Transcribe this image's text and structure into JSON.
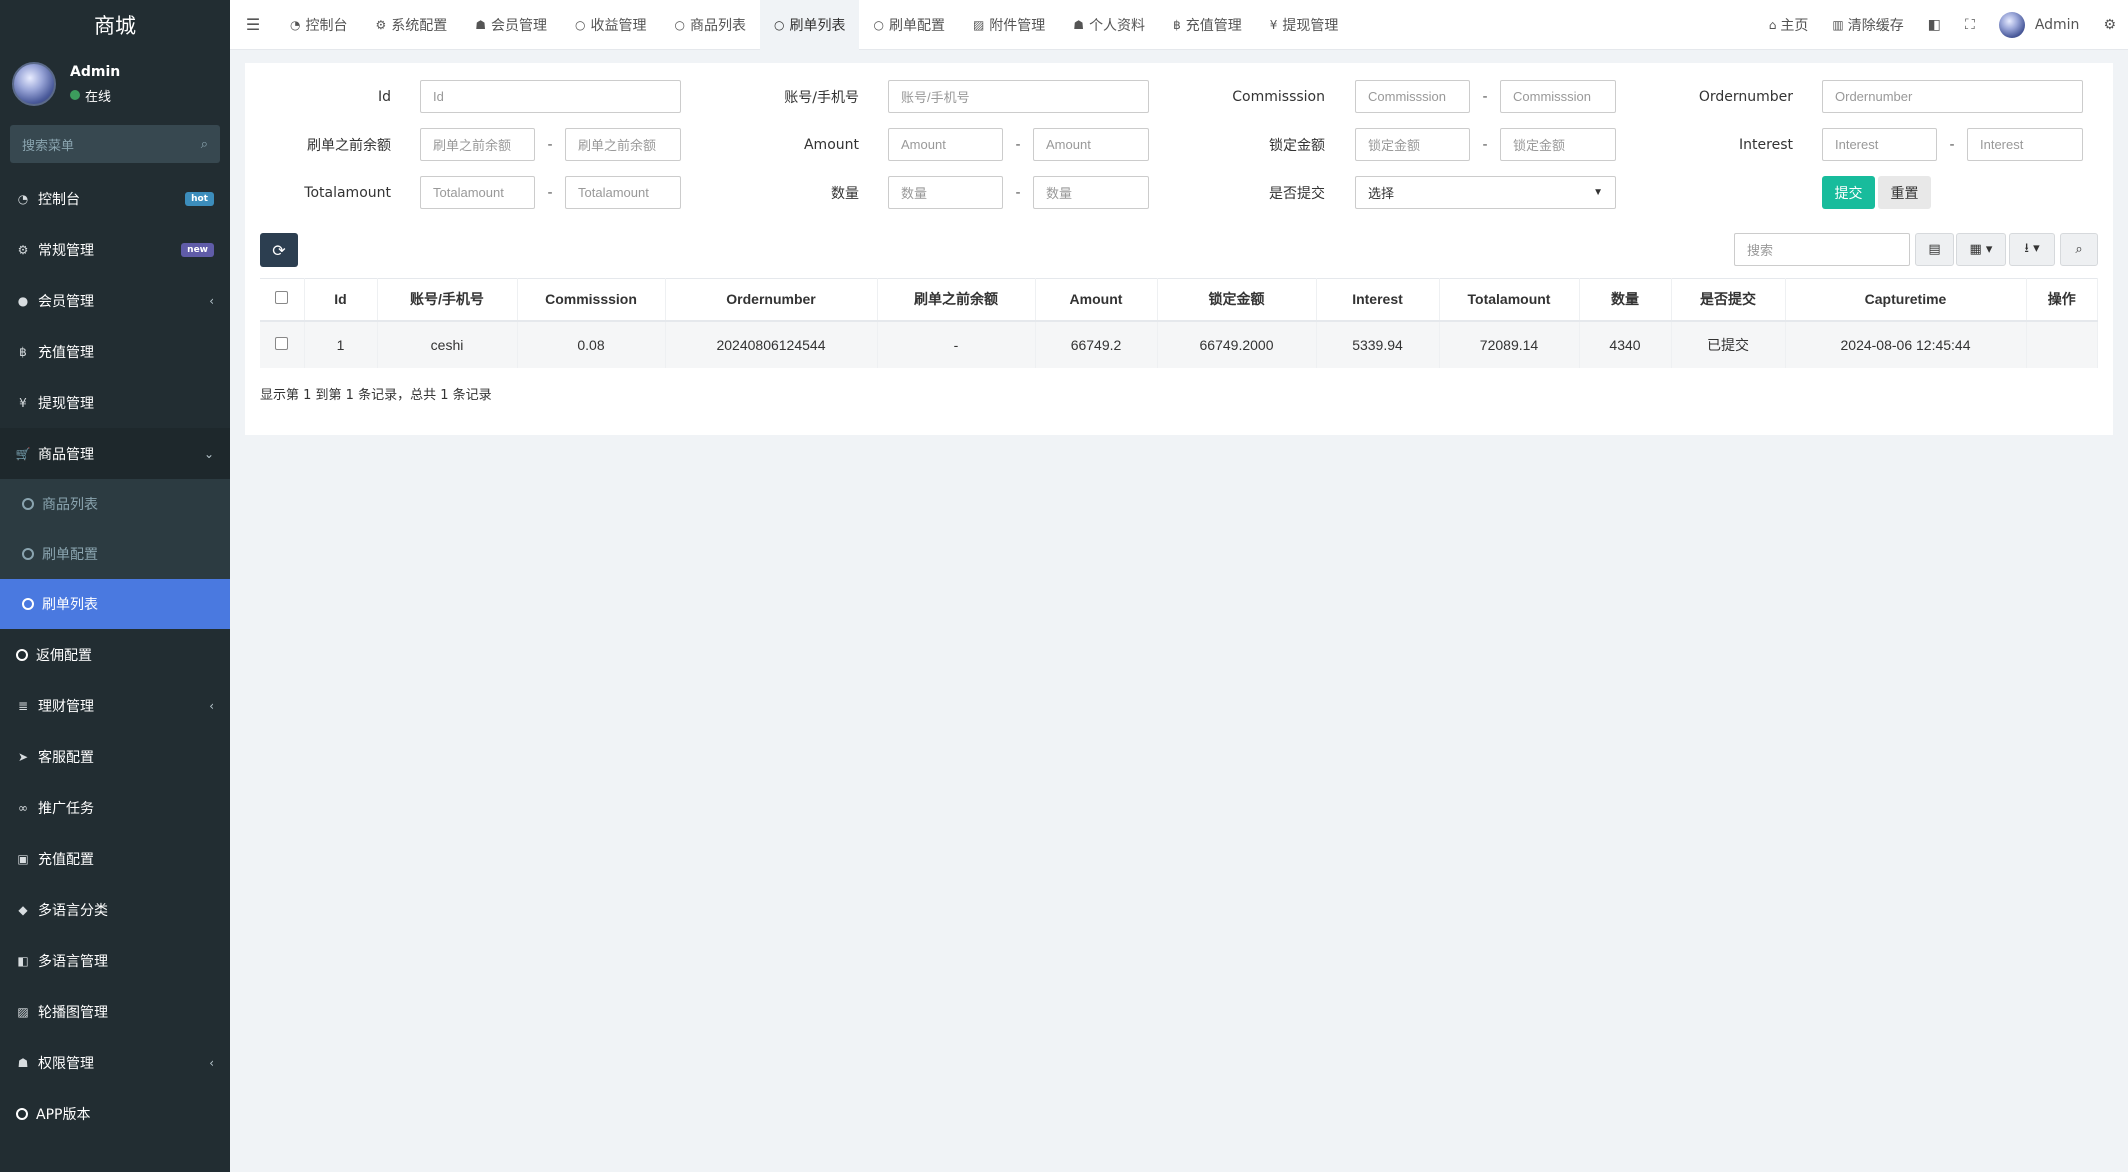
{
  "sidebar": {
    "brand": "商城",
    "user_name": "Admin",
    "user_status": "在线",
    "search_placeholder": "搜索菜单",
    "items": [
      {
        "label": "控制台",
        "icon": "dashboard-icon",
        "glyph": "◔",
        "badge": "hot"
      },
      {
        "label": "常规管理",
        "icon": "cogs-icon",
        "glyph": "⚙",
        "badge": "new"
      },
      {
        "label": "会员管理",
        "icon": "user-circle-icon",
        "glyph": "●",
        "chevron": "‹"
      },
      {
        "label": "充值管理",
        "icon": "bitcoin-icon",
        "glyph": "฿"
      },
      {
        "label": "提现管理",
        "icon": "yen-icon",
        "glyph": "¥"
      },
      {
        "label": "商品管理",
        "icon": "cart-icon",
        "glyph": "🛒",
        "chevron": "⌄"
      },
      {
        "label": "商品列表",
        "sub": true
      },
      {
        "label": "刷单配置",
        "sub": true
      },
      {
        "label": "刷单列表",
        "sub": true,
        "active": true
      },
      {
        "label": "返佣配置",
        "icon": "circle-icon"
      },
      {
        "label": "理财管理",
        "icon": "list-icon",
        "glyph": "≣",
        "chevron": "‹"
      },
      {
        "label": "客服配置",
        "icon": "telegram-icon",
        "glyph": "➤"
      },
      {
        "label": "推广任务",
        "icon": "link-icon",
        "glyph": "∞"
      },
      {
        "label": "充值配置",
        "icon": "money-icon",
        "glyph": "▣"
      },
      {
        "label": "多语言分类",
        "icon": "tag-icon",
        "glyph": "◆"
      },
      {
        "label": "多语言管理",
        "icon": "language-icon",
        "glyph": "◧"
      },
      {
        "label": "轮播图管理",
        "icon": "image-icon",
        "glyph": "▨"
      },
      {
        "label": "权限管理",
        "icon": "group-icon",
        "glyph": "☗",
        "chevron": "‹"
      },
      {
        "label": "APP版本",
        "icon": "circle-icon"
      }
    ]
  },
  "topbar": {
    "tabs": [
      {
        "label": "控制台",
        "icon": "dashboard-icon",
        "glyph": "◔"
      },
      {
        "label": "系统配置",
        "icon": "gear-icon",
        "glyph": "⚙"
      },
      {
        "label": "会员管理",
        "icon": "user-icon",
        "glyph": "☗"
      },
      {
        "label": "收益管理",
        "icon": "circle-icon",
        "glyph": "○"
      },
      {
        "label": "商品列表",
        "icon": "circle-icon",
        "glyph": "○"
      },
      {
        "label": "刷单列表",
        "icon": "circle-icon",
        "glyph": "○",
        "active": true
      },
      {
        "label": "刷单配置",
        "icon": "circle-icon",
        "glyph": "○"
      },
      {
        "label": "附件管理",
        "icon": "file-image-icon",
        "glyph": "▨"
      },
      {
        "label": "个人资料",
        "icon": "user-icon",
        "glyph": "☗"
      },
      {
        "label": "充值管理",
        "icon": "bitcoin-icon",
        "glyph": "฿"
      },
      {
        "label": "提现管理",
        "icon": "yen-icon",
        "glyph": "¥"
      }
    ],
    "home": "主页",
    "clear_cache": "清除缓存",
    "admin": "Admin"
  },
  "filters": {
    "id_label": "Id",
    "id_ph": "Id",
    "account_label": "账号/手机号",
    "account_ph": "账号/手机号",
    "commission_label": "Commisssion",
    "commission_ph": "Commisssion",
    "ordernumber_label": "Ordernumber",
    "ordernumber_ph": "Ordernumber",
    "before_label": "刷单之前余额",
    "before_ph": "刷单之前余额",
    "amount_label": "Amount",
    "amount_ph": "Amount",
    "locked_label": "锁定金额",
    "locked_ph": "锁定金额",
    "interest_label": "Interest",
    "interest_ph": "Interest",
    "total_label": "Totalamount",
    "total_ph": "Totalamount",
    "qty_label": "数量",
    "qty_ph": "数量",
    "submitted_label": "是否提交",
    "submitted_value": "选择",
    "submit": "提交",
    "reset": "重置",
    "dash": "-"
  },
  "toolbar": {
    "search_ph": "搜索"
  },
  "table": {
    "columns": [
      "Id",
      "账号/手机号",
      "Commisssion",
      "Ordernumber",
      "刷单之前余额",
      "Amount",
      "锁定金额",
      "Interest",
      "Totalamount",
      "数量",
      "是否提交",
      "Capturetime",
      "操作"
    ],
    "rows": [
      [
        "1",
        "ceshi",
        "0.08",
        "20240806124544",
        "-",
        "66749.2",
        "66749.2000",
        "5339.94",
        "72089.14",
        "4340",
        "已提交",
        "2024-08-06 12:45:44",
        ""
      ]
    ]
  },
  "pagination": "显示第 1 到第 1 条记录，总共 1 条记录"
}
